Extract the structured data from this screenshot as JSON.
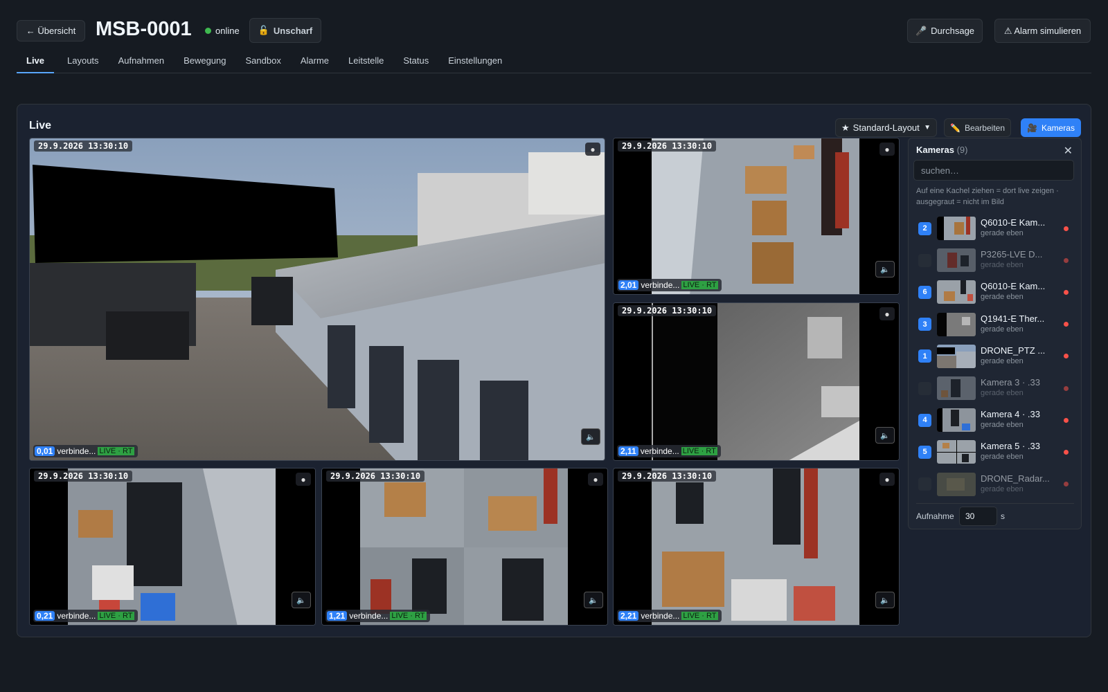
{
  "header": {
    "back_label": "← Übersicht",
    "title": "MSB-0001",
    "online_label": "online",
    "unscharf_label": "Unscharf",
    "durchsage_label": "Durchsage",
    "alarm_label": "⚠ Alarm simulieren"
  },
  "tabs": [
    {
      "label": "Live",
      "active": true
    },
    {
      "label": "Layouts"
    },
    {
      "label": "Aufnahmen"
    },
    {
      "label": "Bewegung"
    },
    {
      "label": "Sandbox"
    },
    {
      "label": "Alarme"
    },
    {
      "label": "Leitstelle"
    },
    {
      "label": "Status"
    },
    {
      "label": "Einstellungen"
    }
  ],
  "panel": {
    "title": "Live",
    "layout_select": "Standard-Layout",
    "edit_label": "Bearbeiten",
    "cameras_label": "Kameras"
  },
  "tiles": [
    {
      "timestamp": "29.9.2026 13:30:10",
      "id": "0,01",
      "state": "verbinde...",
      "live": "LIVE · RT"
    },
    {
      "timestamp": "29.9.2026 13:30:10",
      "id": "2,01",
      "state": "verbinde...",
      "live": "LIVE · RT"
    },
    {
      "timestamp": "29.9.2026 13:30:10",
      "id": "2,11",
      "state": "verbinde...",
      "live": "LIVE · RT"
    },
    {
      "timestamp": "29.9.2026 13:30:10",
      "id": "0,21",
      "state": "verbinde...",
      "live": "LIVE · RT"
    },
    {
      "timestamp": "29.9.2026 13:30:10",
      "id": "1,21",
      "state": "verbinde...",
      "live": "LIVE · RT"
    },
    {
      "timestamp": "29.9.2026 13:30:10",
      "id": "2,21",
      "state": "verbinde...",
      "live": "LIVE · RT"
    }
  ],
  "cameras_panel": {
    "title": "Kameras",
    "count": "(9)",
    "search_placeholder": "suchen…",
    "hint": "Auf eine Kachel ziehen = dort live zeigen · ausgegraut = nicht im Bild",
    "items": [
      {
        "badge": "2",
        "name": "Q6010-E Kam...",
        "sub": "gerade eben",
        "in_view": true
      },
      {
        "badge": "",
        "name": "P3265-LVE D...",
        "sub": "gerade eben",
        "in_view": false
      },
      {
        "badge": "6",
        "name": "Q6010-E Kam...",
        "sub": "gerade eben",
        "in_view": true
      },
      {
        "badge": "3",
        "name": "Q1941-E Ther...",
        "sub": "gerade eben",
        "in_view": true
      },
      {
        "badge": "1",
        "name": "DRONE_PTZ ...",
        "sub": "gerade eben",
        "in_view": true
      },
      {
        "badge": "",
        "name": "Kamera 3 · .33",
        "sub": "gerade eben",
        "in_view": false
      },
      {
        "badge": "4",
        "name": "Kamera 4 · .33",
        "sub": "gerade eben",
        "in_view": true
      },
      {
        "badge": "5",
        "name": "Kamera 5 · .33",
        "sub": "gerade eben",
        "in_view": true
      },
      {
        "badge": "",
        "name": "DRONE_Radar...",
        "sub": "gerade eben",
        "in_view": false
      }
    ],
    "recording_label": "Aufnahme",
    "recording_value": "30",
    "recording_unit": "s"
  },
  "colors": {
    "accent": "#2f81f7",
    "online": "#3fb950",
    "live": "#2ea043",
    "offline_dot": "#f85149"
  }
}
